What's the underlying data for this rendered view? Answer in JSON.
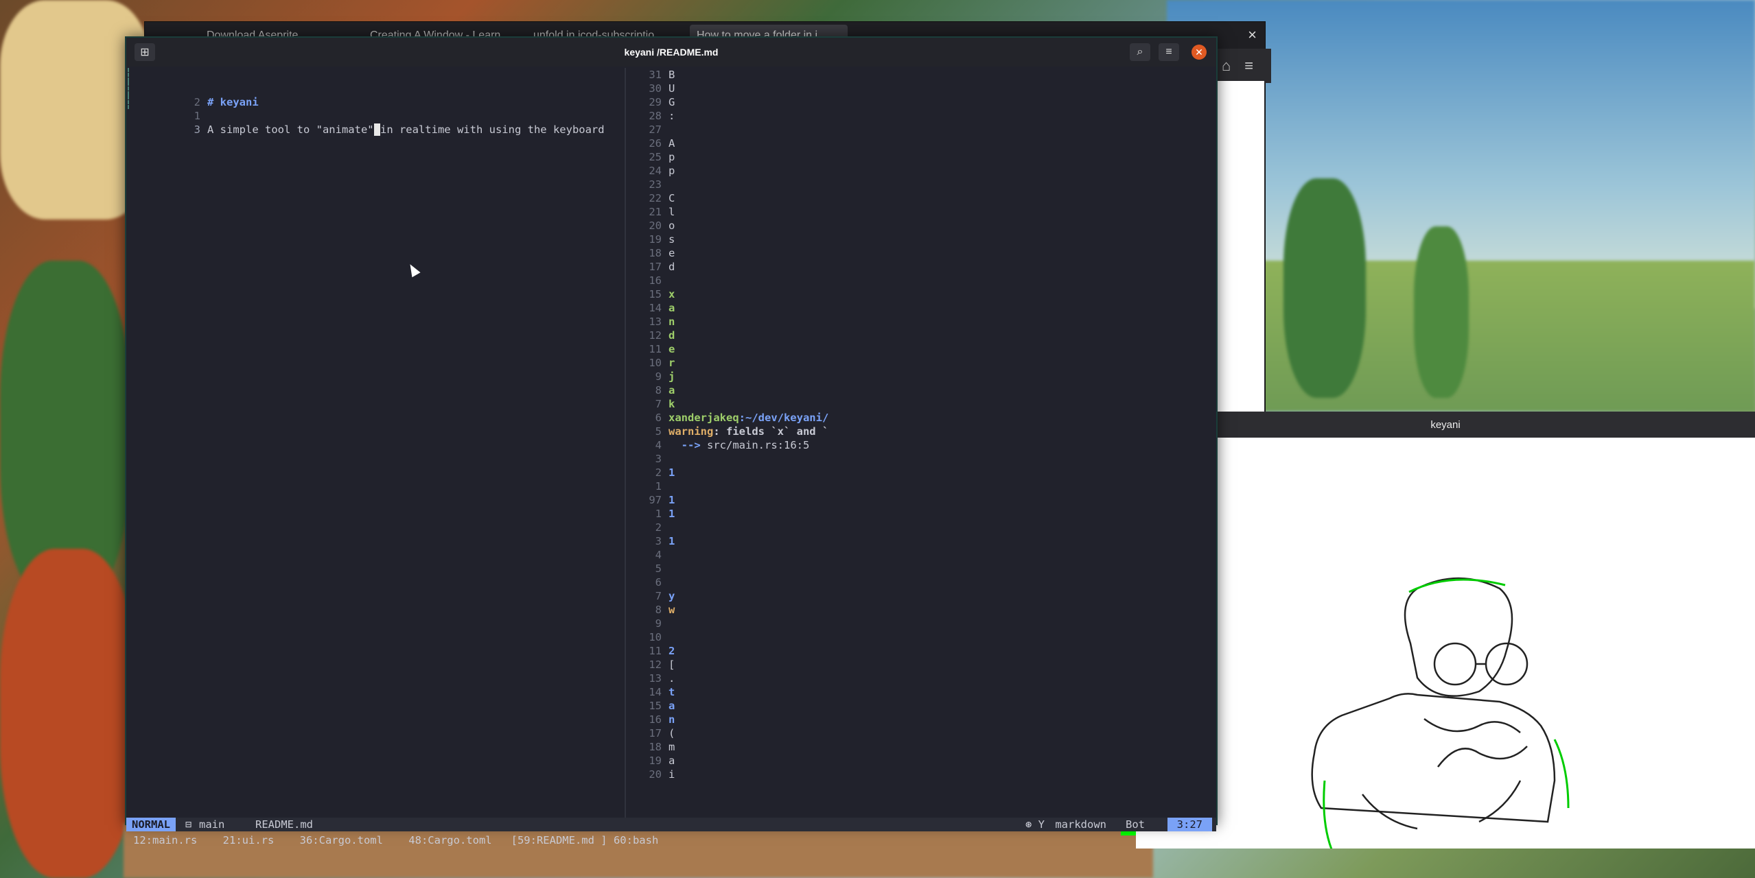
{
  "browser": {
    "tabs": [
      "Download Aseprite",
      "Creating A Window - Learn",
      "unfold in icod-subscriptio",
      "How to move a folder in i"
    ],
    "close_label": "×"
  },
  "keyani_window": {
    "title": "keyani"
  },
  "terminal": {
    "title": "keyani /README.md",
    "left_pane": {
      "lines": [
        {
          "num": "2",
          "text": "# keyani",
          "style": "h1"
        },
        {
          "num": "1",
          "text": "",
          "style": "txt"
        },
        {
          "num": "3",
          "text_before": "A simple tool to \"animate\"",
          "cursor": " ",
          "text_after": "in realtime with using the keyboard",
          "style": "txt"
        }
      ]
    },
    "right_pane": {
      "lines": [
        {
          "num": "31",
          "text": "B",
          "c": "w"
        },
        {
          "num": "30",
          "text": "U",
          "c": "w"
        },
        {
          "num": "29",
          "text": "G",
          "c": "w"
        },
        {
          "num": "28",
          "text": ":",
          "c": "w"
        },
        {
          "num": "27",
          "text": "",
          "c": "w"
        },
        {
          "num": "26",
          "text": "A",
          "c": "w"
        },
        {
          "num": "25",
          "text": "p",
          "c": "w"
        },
        {
          "num": "24",
          "text": "p",
          "c": "w"
        },
        {
          "num": "23",
          "text": "",
          "c": "w"
        },
        {
          "num": "22",
          "text": "C",
          "c": "w"
        },
        {
          "num": "21",
          "text": "l",
          "c": "w"
        },
        {
          "num": "20",
          "text": "o",
          "c": "w"
        },
        {
          "num": "19",
          "text": "s",
          "c": "w"
        },
        {
          "num": "18",
          "text": "e",
          "c": "w"
        },
        {
          "num": "17",
          "text": "d",
          "c": "w"
        },
        {
          "num": "16",
          "text": "",
          "c": "w"
        },
        {
          "num": "15",
          "text": "x",
          "c": "g"
        },
        {
          "num": "14",
          "text": "a",
          "c": "g"
        },
        {
          "num": "13",
          "text": "n",
          "c": "g"
        },
        {
          "num": "12",
          "text": "d",
          "c": "g"
        },
        {
          "num": "11",
          "text": "e",
          "c": "g"
        },
        {
          "num": "10",
          "text": "r",
          "c": "g"
        },
        {
          "num": "9",
          "text": "j",
          "c": "g"
        },
        {
          "num": "8",
          "text": "a",
          "c": "g"
        },
        {
          "num": "7",
          "text": "k",
          "c": "g"
        },
        {
          "num": "6",
          "text": "xanderjakeq:~/dev/keyani/",
          "c": "prompt"
        },
        {
          "num": "5",
          "text": "warning: fields `x` and `",
          "c": "warn"
        },
        {
          "num": "4",
          "text": "  --> src/main.rs:16:5",
          "c": "arrow"
        },
        {
          "num": "3",
          "text": "",
          "c": "w"
        },
        {
          "num": "2",
          "text": "1",
          "c": "b"
        },
        {
          "num": "1",
          "text": "",
          "c": "w"
        },
        {
          "num": "97",
          "text": "1",
          "c": "b"
        },
        {
          "num": "1",
          "text": "1",
          "c": "b"
        },
        {
          "num": "2",
          "text": "",
          "c": "w"
        },
        {
          "num": "3",
          "text": "1",
          "c": "b"
        },
        {
          "num": "4",
          "text": "",
          "c": "w"
        },
        {
          "num": "5",
          "text": "",
          "c": "w"
        },
        {
          "num": "6",
          "text": "",
          "c": "w"
        },
        {
          "num": "7",
          "text": "y",
          "c": "b"
        },
        {
          "num": "8",
          "text": "w",
          "c": "y"
        },
        {
          "num": "9",
          "text": "",
          "c": "w"
        },
        {
          "num": "10",
          "text": "",
          "c": "w"
        },
        {
          "num": "11",
          "text": "2",
          "c": "b"
        },
        {
          "num": "12",
          "text": "[",
          "c": "w"
        },
        {
          "num": "13",
          "text": ".",
          "c": "w"
        },
        {
          "num": "14",
          "text": "t",
          "c": "b"
        },
        {
          "num": "15",
          "text": "a",
          "c": "b"
        },
        {
          "num": "16",
          "text": "n",
          "c": "b"
        },
        {
          "num": "17",
          "text": "(",
          "c": "w"
        },
        {
          "num": "18",
          "text": "m",
          "c": "w"
        },
        {
          "num": "19",
          "text": "a",
          "c": "w"
        },
        {
          "num": "20",
          "text": "i",
          "c": "w"
        }
      ]
    },
    "statusbar": {
      "mode": "NORMAL",
      "branch": "main",
      "filename": "README.md",
      "filetype": "markdown",
      "scroll": "Bot",
      "position": "3:27"
    },
    "buffers": [
      "12:main.rs",
      "21:ui.rs",
      "36:Cargo.toml",
      "48:Cargo.toml",
      "[59:README.md ]",
      "60:bash"
    ]
  }
}
